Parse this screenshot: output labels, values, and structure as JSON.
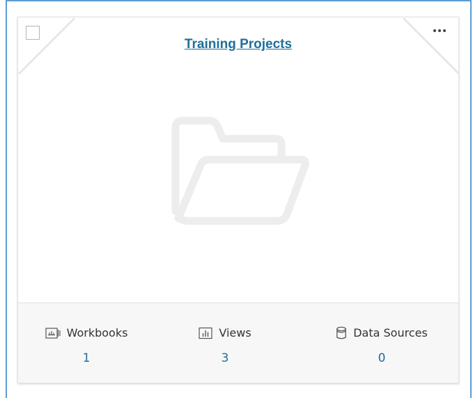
{
  "card": {
    "title": "Training Projects",
    "thumbnail_icon": "folder-icon",
    "menu_icon": "more-horizontal-icon",
    "checkbox_checked": false
  },
  "stats": [
    {
      "label": "Workbooks",
      "value": "1",
      "icon": "workbook-icon"
    },
    {
      "label": "Views",
      "value": "3",
      "icon": "view-chart-icon"
    },
    {
      "label": "Data Sources",
      "value": "0",
      "icon": "database-icon"
    }
  ],
  "colors": {
    "accent_link": "#1f6e9c",
    "selection_border": "#5b9bd5",
    "folder_gray": "#ededed",
    "footer_bg": "#f7f7f7"
  }
}
